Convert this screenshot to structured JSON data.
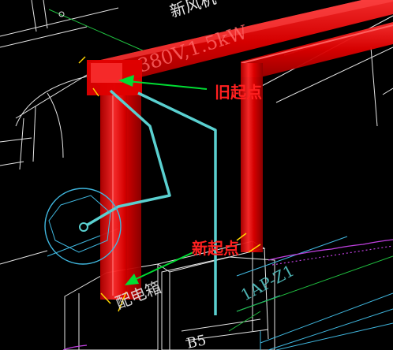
{
  "viewport": {
    "background": "#000000",
    "tool": "cad-drawing-canvas"
  },
  "labels": {
    "old_start": "旧起点",
    "new_start": "新起点",
    "cable_spec": "380V,1.5kW",
    "top_text": "新风机",
    "bottom_text_1": "配电箱",
    "bottom_text_2": "1AP-Z1",
    "bottom_text_3": "B5"
  },
  "colors": {
    "annotation": "#ff2020",
    "leader": "#00dd33",
    "pipe": "#e00000",
    "pipe_highlight": "#ff5050",
    "route": "#5ad0d0",
    "grid_cyan": "#40b8e0",
    "grid_white": "#e6e6e6",
    "magenta": "#c040e0",
    "yellow": "#ffd400",
    "green_line": "#20c040"
  }
}
